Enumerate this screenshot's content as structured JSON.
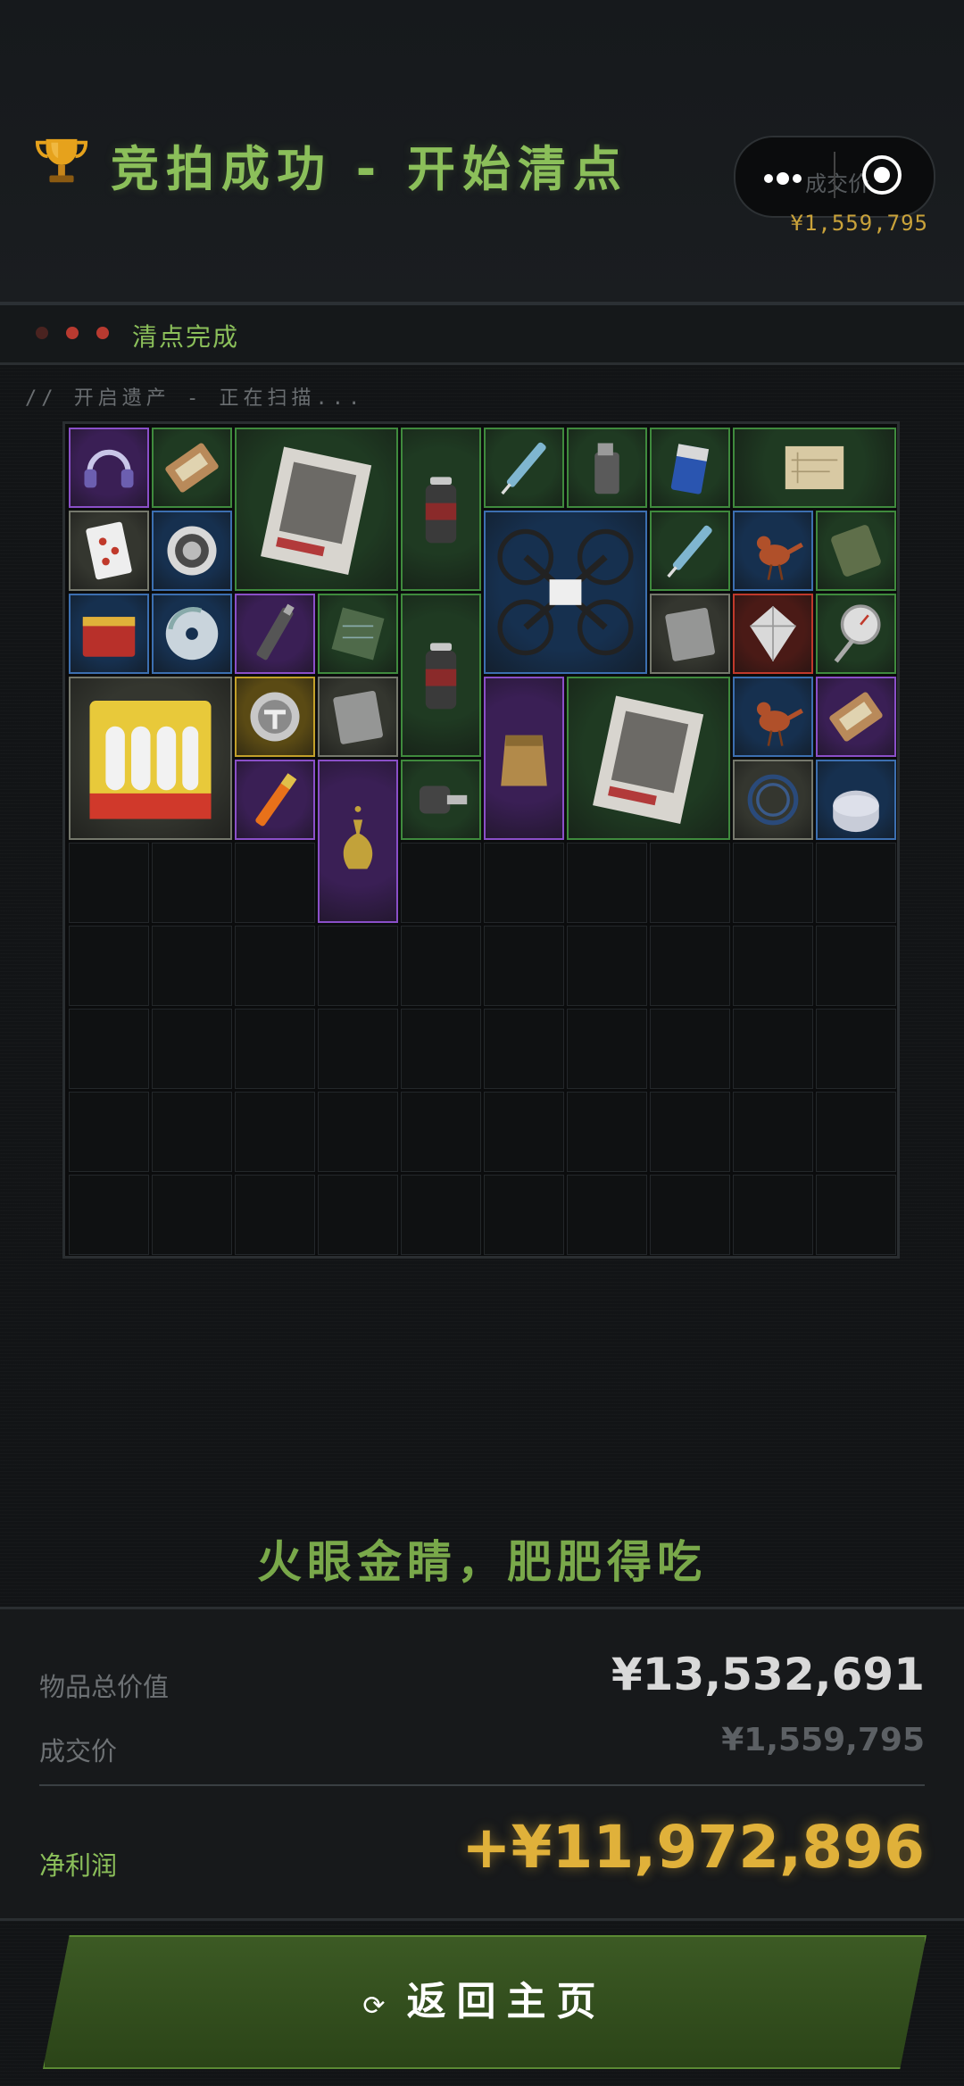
{
  "header": {
    "title": "竞拍成功 - 开始清点",
    "capsule_label": "成交价",
    "deal_price": "¥1,559,795"
  },
  "status": {
    "text": "清点完成"
  },
  "scan": {
    "label": "// 开启遗产 - 正在扫描..."
  },
  "grid": {
    "cols": 10,
    "rows": 10,
    "items": [
      {
        "name": "headset",
        "c": 0,
        "r": 0,
        "w": 1,
        "h": 1,
        "rarity": "purple",
        "icon": "headset-icon"
      },
      {
        "name": "ration-bar",
        "c": 1,
        "r": 0,
        "w": 1,
        "h": 1,
        "rarity": "green",
        "icon": "food-bar-icon"
      },
      {
        "name": "magazine",
        "c": 2,
        "r": 0,
        "w": 2,
        "h": 2,
        "rarity": "green",
        "icon": "magazine-icon"
      },
      {
        "name": "spray-can",
        "c": 4,
        "r": 0,
        "w": 1,
        "h": 2,
        "rarity": "green",
        "icon": "spray-can-icon"
      },
      {
        "name": "syringe",
        "c": 5,
        "r": 0,
        "w": 1,
        "h": 1,
        "rarity": "green",
        "icon": "syringe-icon"
      },
      {
        "name": "lighter",
        "c": 6,
        "r": 0,
        "w": 1,
        "h": 1,
        "rarity": "green",
        "icon": "lighter-icon"
      },
      {
        "name": "battery",
        "c": 7,
        "r": 0,
        "w": 1,
        "h": 1,
        "rarity": "green",
        "icon": "battery-icon"
      },
      {
        "name": "map-scroll",
        "c": 8,
        "r": 0,
        "w": 2,
        "h": 1,
        "rarity": "green",
        "icon": "map-icon"
      },
      {
        "name": "playing-card",
        "c": 0,
        "r": 1,
        "w": 1,
        "h": 1,
        "rarity": "gray",
        "icon": "card-icon"
      },
      {
        "name": "coin-badge",
        "c": 1,
        "r": 1,
        "w": 1,
        "h": 1,
        "rarity": "blue",
        "icon": "coin-icon"
      },
      {
        "name": "drone",
        "c": 5,
        "r": 1,
        "w": 2,
        "h": 2,
        "rarity": "blue",
        "icon": "drone-icon"
      },
      {
        "name": "syringe-2",
        "c": 7,
        "r": 1,
        "w": 1,
        "h": 1,
        "rarity": "green",
        "icon": "syringe-icon"
      },
      {
        "name": "bird-figurine",
        "c": 8,
        "r": 1,
        "w": 1,
        "h": 1,
        "rarity": "blue",
        "icon": "bird-icon"
      },
      {
        "name": "mre-pack",
        "c": 9,
        "r": 1,
        "w": 1,
        "h": 1,
        "rarity": "green",
        "icon": "pack-icon"
      },
      {
        "name": "tea-tin",
        "c": 0,
        "r": 2,
        "w": 1,
        "h": 1,
        "rarity": "blue",
        "icon": "tin-icon"
      },
      {
        "name": "cd-disc",
        "c": 1,
        "r": 2,
        "w": 1,
        "h": 1,
        "rarity": "blue",
        "icon": "disc-icon"
      },
      {
        "name": "usb-stick",
        "c": 2,
        "r": 2,
        "w": 1,
        "h": 1,
        "rarity": "purple",
        "icon": "usb-icon"
      },
      {
        "name": "circuit-chip",
        "c": 3,
        "r": 2,
        "w": 1,
        "h": 1,
        "rarity": "green",
        "icon": "chip-icon"
      },
      {
        "name": "spray-can-2",
        "c": 4,
        "r": 2,
        "w": 1,
        "h": 2,
        "rarity": "green",
        "icon": "spray-can-icon"
      },
      {
        "name": "plastic-bag",
        "c": 7,
        "r": 2,
        "w": 1,
        "h": 1,
        "rarity": "gray",
        "icon": "bag-icon"
      },
      {
        "name": "diamond",
        "c": 8,
        "r": 2,
        "w": 1,
        "h": 1,
        "rarity": "red",
        "icon": "gem-icon"
      },
      {
        "name": "pressure-gauge",
        "c": 9,
        "r": 2,
        "w": 1,
        "h": 1,
        "rarity": "green",
        "icon": "gauge-icon"
      },
      {
        "name": "candle-pack",
        "c": 0,
        "r": 3,
        "w": 2,
        "h": 2,
        "rarity": "gray",
        "icon": "candle-icon"
      },
      {
        "name": "gold-emblem",
        "c": 2,
        "r": 3,
        "w": 1,
        "h": 1,
        "rarity": "gold",
        "icon": "emblem-icon"
      },
      {
        "name": "foil-packet",
        "c": 3,
        "r": 3,
        "w": 1,
        "h": 1,
        "rarity": "gray",
        "icon": "bag-icon"
      },
      {
        "name": "leather-pouch",
        "c": 5,
        "r": 3,
        "w": 1,
        "h": 2,
        "rarity": "purple",
        "icon": "pouch-icon"
      },
      {
        "name": "magazine-2",
        "c": 6,
        "r": 3,
        "w": 2,
        "h": 2,
        "rarity": "green",
        "icon": "magazine-icon"
      },
      {
        "name": "bird-figurine-2",
        "c": 8,
        "r": 3,
        "w": 1,
        "h": 1,
        "rarity": "blue",
        "icon": "bird-icon"
      },
      {
        "name": "chocolate-bar",
        "c": 9,
        "r": 3,
        "w": 1,
        "h": 1,
        "rarity": "purple",
        "icon": "food-bar-icon"
      },
      {
        "name": "flare",
        "c": 2,
        "r": 4,
        "w": 1,
        "h": 1,
        "rarity": "purple",
        "icon": "flare-icon"
      },
      {
        "name": "hookah-vase",
        "c": 3,
        "r": 4,
        "w": 1,
        "h": 2,
        "rarity": "purple",
        "icon": "vase-icon"
      },
      {
        "name": "car-key",
        "c": 4,
        "r": 4,
        "w": 1,
        "h": 1,
        "rarity": "green",
        "icon": "key-icon"
      },
      {
        "name": "cable-coil",
        "c": 8,
        "r": 4,
        "w": 1,
        "h": 1,
        "rarity": "gray",
        "icon": "cable-icon"
      },
      {
        "name": "tape-roll",
        "c": 9,
        "r": 4,
        "w": 1,
        "h": 1,
        "rarity": "blue",
        "icon": "tape-icon"
      }
    ]
  },
  "rarity_colors": {
    "purple": {
      "bg": "#3a1f55",
      "border": "#8a4fc8"
    },
    "green": {
      "bg": "#1f3a22",
      "border": "#3f8a3d"
    },
    "blue": {
      "bg": "#16304f",
      "border": "#3c6fb0"
    },
    "gray": {
      "bg": "#34362f",
      "border": "#75786c"
    },
    "gold": {
      "bg": "#5a4a14",
      "border": "#c2a02a"
    },
    "red": {
      "bg": "#4a1a16",
      "border": "#c0392b"
    }
  },
  "slogan": "火眼金睛，肥肥得吃",
  "summary": {
    "total_label": "物品总价值",
    "total_value": "¥13,532,691",
    "deal_label": "成交价",
    "deal_value": "¥1,559,795",
    "profit_label": "净利润",
    "profit_value": "+¥11,972,896"
  },
  "button": {
    "icon": "⟳",
    "label": "返回主页"
  },
  "colors": {
    "accent_green": "#8bbf5a",
    "gold": "#e0b13a",
    "status_dot": "#c0392b"
  }
}
